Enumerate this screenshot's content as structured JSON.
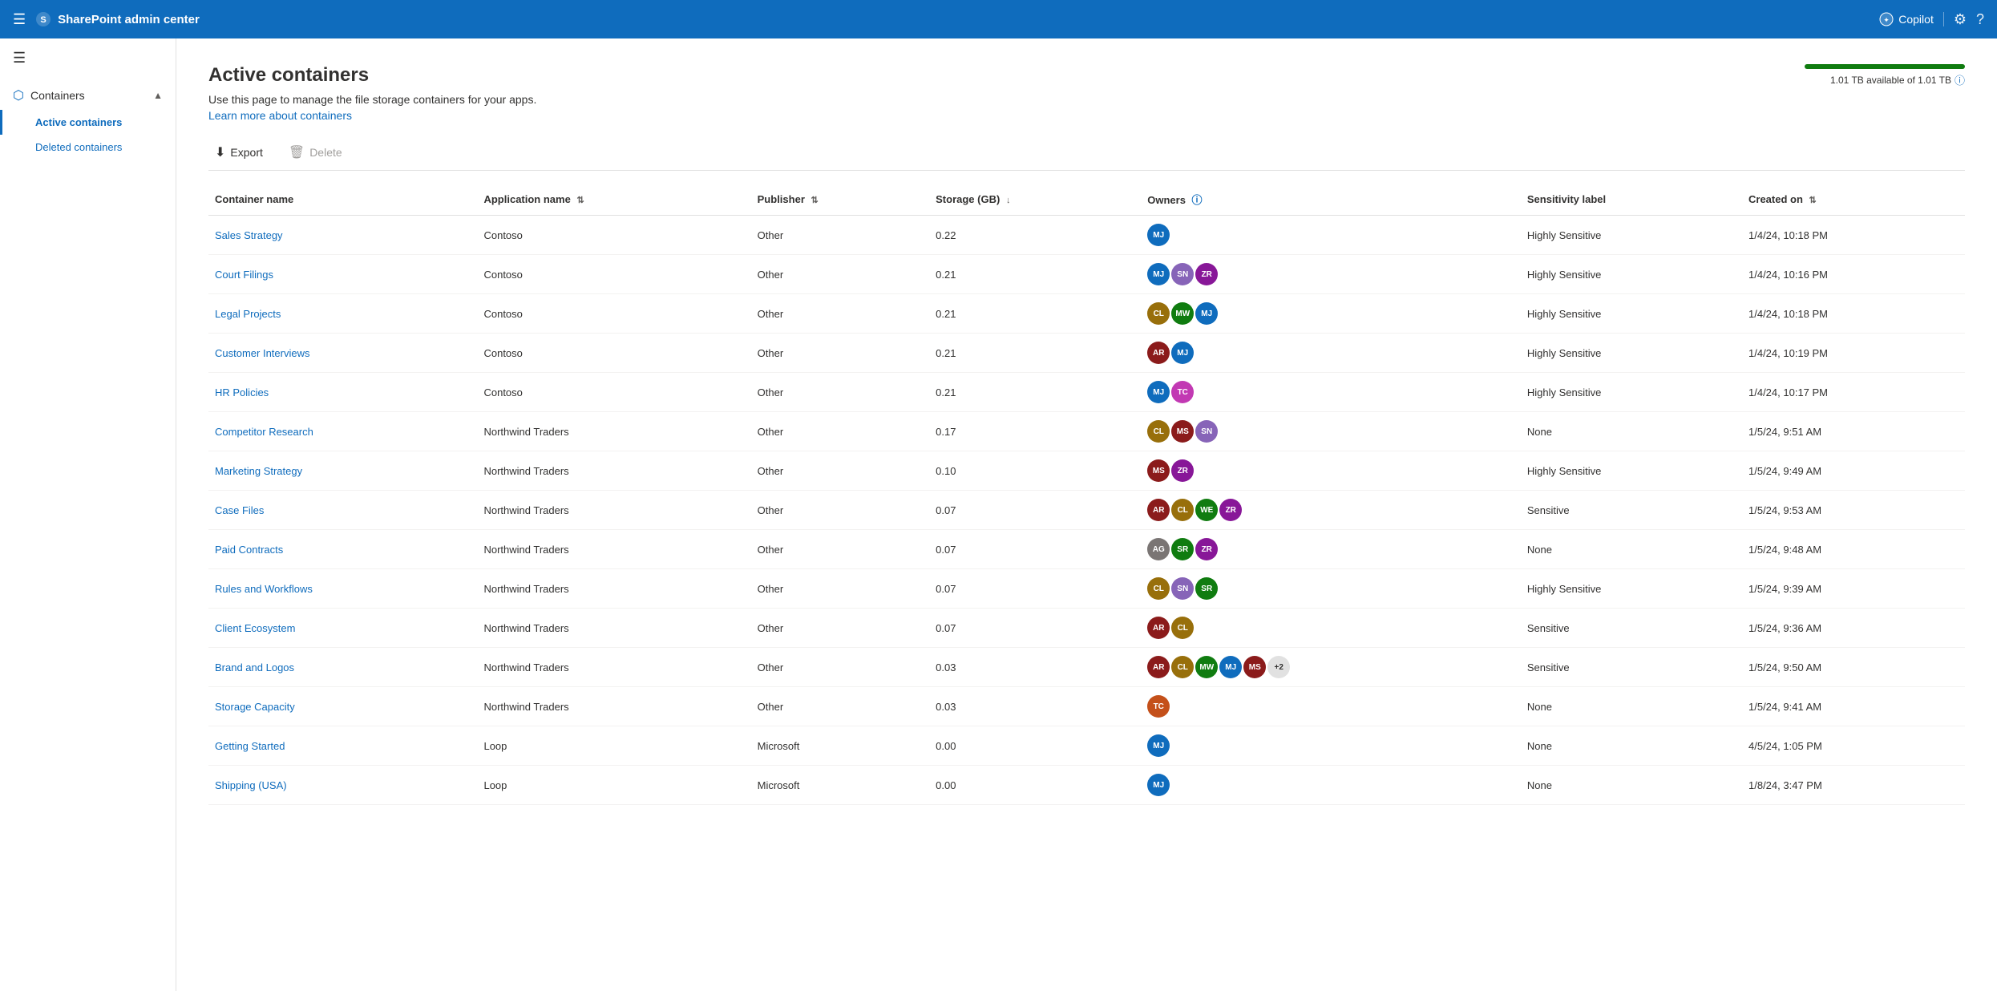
{
  "topbar": {
    "app_name": "SharePoint admin center",
    "copilot_label": "Copilot",
    "settings_icon": "⚙",
    "help_icon": "?"
  },
  "sidebar": {
    "hamburger": "☰",
    "containers_label": "Containers",
    "containers_icon": "⬡",
    "active_containers_label": "Active containers",
    "deleted_containers_label": "Deleted containers"
  },
  "page": {
    "title": "Active containers",
    "description": "Use this page to manage the file storage containers for your apps.",
    "link_text": "Learn more about containers",
    "storage_label": "1.01 TB available of 1.01 TB"
  },
  "toolbar": {
    "export_label": "Export",
    "delete_label": "Delete"
  },
  "table": {
    "columns": [
      {
        "key": "container_name",
        "label": "Container name"
      },
      {
        "key": "app_name",
        "label": "Application name",
        "sortable": true
      },
      {
        "key": "publisher",
        "label": "Publisher",
        "sortable": true
      },
      {
        "key": "storage",
        "label": "Storage (GB)",
        "sortable": true,
        "sort_dir": "desc"
      },
      {
        "key": "owners",
        "label": "Owners",
        "info": true
      },
      {
        "key": "sensitivity",
        "label": "Sensitivity label"
      },
      {
        "key": "created_on",
        "label": "Created on",
        "sortable": true
      }
    ],
    "rows": [
      {
        "container_name": "Sales Strategy",
        "app_name": "Contoso",
        "publisher": "Other",
        "storage": "0.22",
        "owners": [
          {
            "initials": "MJ",
            "color": "#0f6cbd"
          }
        ],
        "sensitivity": "Highly Sensitive",
        "created_on": "1/4/24, 10:18 PM"
      },
      {
        "container_name": "Court Filings",
        "app_name": "Contoso",
        "publisher": "Other",
        "storage": "0.21",
        "owners": [
          {
            "initials": "MJ",
            "color": "#0f6cbd"
          },
          {
            "initials": "SN",
            "color": "#8764b8"
          },
          {
            "initials": "ZR",
            "color": "#881798"
          }
        ],
        "sensitivity": "Highly Sensitive",
        "created_on": "1/4/24, 10:16 PM"
      },
      {
        "container_name": "Legal Projects",
        "app_name": "Contoso",
        "publisher": "Other",
        "storage": "0.21",
        "owners": [
          {
            "initials": "CL",
            "color": "#986f0b"
          },
          {
            "initials": "MW",
            "color": "#107c10"
          },
          {
            "initials": "MJ",
            "color": "#0f6cbd"
          }
        ],
        "sensitivity": "Highly Sensitive",
        "created_on": "1/4/24, 10:18 PM"
      },
      {
        "container_name": "Customer Interviews",
        "app_name": "Contoso",
        "publisher": "Other",
        "storage": "0.21",
        "owners": [
          {
            "initials": "AR",
            "color": "#8b1b1b"
          },
          {
            "initials": "MJ",
            "color": "#0f6cbd"
          }
        ],
        "sensitivity": "Highly Sensitive",
        "created_on": "1/4/24, 10:19 PM"
      },
      {
        "container_name": "HR Policies",
        "app_name": "Contoso",
        "publisher": "Other",
        "storage": "0.21",
        "owners": [
          {
            "initials": "MJ",
            "color": "#0f6cbd"
          },
          {
            "initials": "TC",
            "color": "#c239b3"
          }
        ],
        "sensitivity": "Highly Sensitive",
        "created_on": "1/4/24, 10:17 PM"
      },
      {
        "container_name": "Competitor Research",
        "app_name": "Northwind Traders",
        "publisher": "Other",
        "storage": "0.17",
        "owners": [
          {
            "initials": "CL",
            "color": "#986f0b"
          },
          {
            "initials": "MS",
            "color": "#8b1b1b"
          },
          {
            "initials": "SN",
            "color": "#8764b8"
          }
        ],
        "sensitivity": "None",
        "created_on": "1/5/24, 9:51 AM"
      },
      {
        "container_name": "Marketing Strategy",
        "app_name": "Northwind Traders",
        "publisher": "Other",
        "storage": "0.10",
        "owners": [
          {
            "initials": "MS",
            "color": "#8b1b1b"
          },
          {
            "initials": "ZR",
            "color": "#881798"
          }
        ],
        "sensitivity": "Highly Sensitive",
        "created_on": "1/5/24, 9:49 AM"
      },
      {
        "container_name": "Case Files",
        "app_name": "Northwind Traders",
        "publisher": "Other",
        "storage": "0.07",
        "owners": [
          {
            "initials": "AR",
            "color": "#8b1b1b"
          },
          {
            "initials": "CL",
            "color": "#986f0b"
          },
          {
            "initials": "WE",
            "color": "#107c10"
          },
          {
            "initials": "ZR",
            "color": "#881798"
          }
        ],
        "sensitivity": "Sensitive",
        "created_on": "1/5/24, 9:53 AM"
      },
      {
        "container_name": "Paid Contracts",
        "app_name": "Northwind Traders",
        "publisher": "Other",
        "storage": "0.07",
        "owners": [
          {
            "initials": "AG",
            "color": "#7a7574"
          },
          {
            "initials": "SR",
            "color": "#107c10"
          },
          {
            "initials": "ZR",
            "color": "#881798"
          }
        ],
        "sensitivity": "None",
        "created_on": "1/5/24, 9:48 AM"
      },
      {
        "container_name": "Rules and Workflows",
        "app_name": "Northwind Traders",
        "publisher": "Other",
        "storage": "0.07",
        "owners": [
          {
            "initials": "CL",
            "color": "#986f0b"
          },
          {
            "initials": "SN",
            "color": "#8764b8"
          },
          {
            "initials": "SR",
            "color": "#107c10"
          }
        ],
        "sensitivity": "Highly Sensitive",
        "created_on": "1/5/24, 9:39 AM"
      },
      {
        "container_name": "Client Ecosystem",
        "app_name": "Northwind Traders",
        "publisher": "Other",
        "storage": "0.07",
        "owners": [
          {
            "initials": "AR",
            "color": "#8b1b1b"
          },
          {
            "initials": "CL",
            "color": "#986f0b"
          }
        ],
        "sensitivity": "Sensitive",
        "created_on": "1/5/24, 9:36 AM"
      },
      {
        "container_name": "Brand and Logos",
        "app_name": "Northwind Traders",
        "publisher": "Other",
        "storage": "0.03",
        "owners": [
          {
            "initials": "AR",
            "color": "#8b1b1b"
          },
          {
            "initials": "CL",
            "color": "#986f0b"
          },
          {
            "initials": "MW",
            "color": "#107c10"
          },
          {
            "initials": "MJ",
            "color": "#0f6cbd"
          },
          {
            "initials": "MS",
            "color": "#8b1b1b"
          }
        ],
        "owners_extra": "+2",
        "sensitivity": "Sensitive",
        "created_on": "1/5/24, 9:50 AM"
      },
      {
        "container_name": "Storage Capacity",
        "app_name": "Northwind Traders",
        "publisher": "Other",
        "storage": "0.03",
        "owners": [
          {
            "initials": "TC",
            "color": "#c4501a"
          }
        ],
        "sensitivity": "None",
        "created_on": "1/5/24, 9:41 AM"
      },
      {
        "container_name": "Getting Started",
        "app_name": "Loop",
        "publisher": "Microsoft",
        "storage": "0.00",
        "owners": [
          {
            "initials": "MJ",
            "color": "#0f6cbd"
          }
        ],
        "sensitivity": "None",
        "created_on": "4/5/24, 1:05 PM"
      },
      {
        "container_name": "Shipping (USA)",
        "app_name": "Loop",
        "publisher": "Microsoft",
        "storage": "0.00",
        "owners": [
          {
            "initials": "MJ",
            "color": "#0f6cbd"
          }
        ],
        "sensitivity": "None",
        "created_on": "1/8/24, 3:47 PM"
      }
    ]
  }
}
